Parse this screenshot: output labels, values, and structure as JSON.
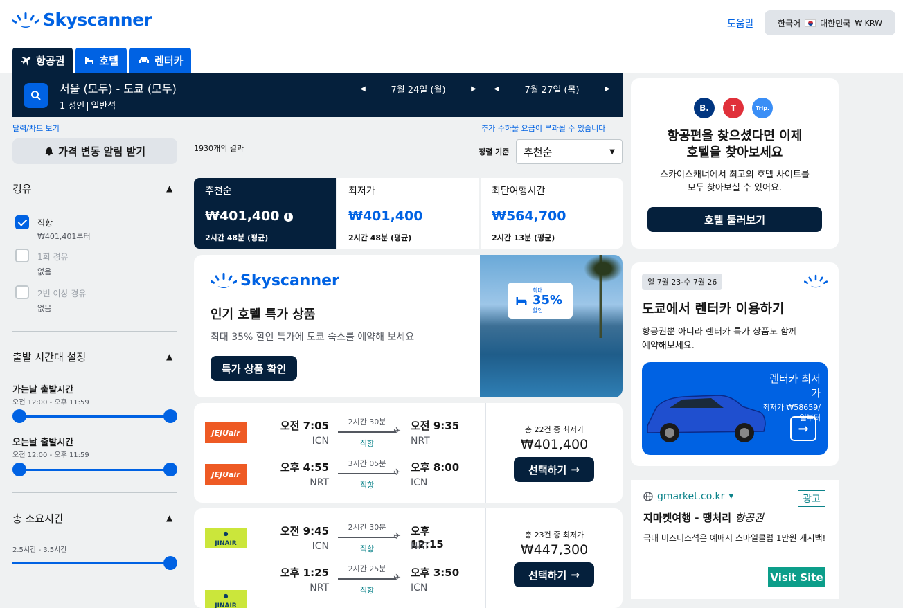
{
  "header": {
    "brand": "Skyscanner",
    "help": "도움말",
    "locale": {
      "language": "한국어",
      "country": "대한민국",
      "currency": "₩ KRW"
    }
  },
  "tabs": [
    {
      "label": "항공권",
      "icon": "plane-icon"
    },
    {
      "label": "호텔",
      "icon": "bed-icon"
    },
    {
      "label": "렌터카",
      "icon": "car-icon"
    }
  ],
  "search": {
    "route": "서울 (모두) - 도쿄 (모두)",
    "passengers": "1 성인",
    "cabin": "일반석",
    "depart_date": "7월 24일 (월)",
    "return_date": "7월 27일 (목)"
  },
  "links": {
    "calendar": "달력/차트 보기",
    "fees": "추가 수하물 요금이 부과될 수 있습니다"
  },
  "filters": {
    "price_alert": "가격 변동 알림 받기",
    "stops": {
      "title": "경유",
      "options": [
        {
          "label": "직항",
          "sub": "₩401,401부터",
          "checked": true
        },
        {
          "label": "1회 경유",
          "sub": "없음",
          "checked": false
        },
        {
          "label": "2번 이상 경유",
          "sub": "없음",
          "checked": false
        }
      ]
    },
    "departure": {
      "title": "출발 시간대 설정",
      "outbound_label": "가는날 출발시간",
      "outbound_range": "오전 12:00 - 오후 11:59",
      "return_label": "오는날 출발시간",
      "return_range": "오전 12:00 - 오후 11:59"
    },
    "duration": {
      "title": "총 소요시간",
      "range": "2.5시간 - 3.5시간"
    }
  },
  "results": {
    "count": "1930개의 결과",
    "sort_label": "정렬 기준",
    "sort_value": "추천순"
  },
  "sort_tabs": [
    {
      "name": "추천순",
      "price": "₩401,400",
      "duration": "2시간 48분 (평균)"
    },
    {
      "name": "최저가",
      "price": "₩401,400",
      "duration": "2시간 48분 (평균)"
    },
    {
      "name": "최단여행시간",
      "price": "₩564,700",
      "duration": "2시간 13분 (평균)"
    }
  ],
  "promo": {
    "brand": "Skyscanner",
    "title": "인기 호텔 특가 상품",
    "desc": "최대 35% 할인 특가에 도쿄 숙소를 예약해 보세요",
    "button": "특가 상품 확인",
    "badge_top": "최대",
    "badge_pct": "35%",
    "badge_bottom": "할인"
  },
  "flights": [
    {
      "airline": "JEJUair",
      "legs": [
        {
          "dep": "오전 7:05",
          "dep_code": "ICN",
          "dur": "2시간 30분",
          "dir": "직항",
          "arr": "오전 9:35",
          "arr_code": "NRT"
        },
        {
          "dep": "오후 4:55",
          "dep_code": "NRT",
          "dur": "3시간 05분",
          "dir": "직항",
          "arr": "오후 8:00",
          "arr_code": "ICN"
        }
      ],
      "deals": "총 22건 중 최저가",
      "price": "₩401,400",
      "button": "선택하기"
    },
    {
      "airline": "JINAIR",
      "legs": [
        {
          "dep": "오전 9:45",
          "dep_code": "ICN",
          "dur": "2시간 30분",
          "dir": "직항",
          "arr": "오후 12:15",
          "arr_code": "NRT"
        },
        {
          "dep": "오후 1:25",
          "dep_code": "NRT",
          "dur": "2시간 25분",
          "dir": "직항",
          "arr": "오후 3:50",
          "arr_code": "ICN"
        }
      ],
      "deals": "총 23건 중 최저가",
      "price": "₩447,300",
      "button": "선택하기"
    }
  ],
  "hotel_card": {
    "logos": [
      "B.",
      "T",
      "Trip."
    ],
    "title1": "항공편을 찾으셨다면 이제",
    "title2": "호텔을 찾아보세요",
    "text1": "스카이스캐너에서 최고의 호텔 사이트를",
    "text2": "모두 찾아보실 수 있어요.",
    "button": "호텔 둘러보기"
  },
  "car_card": {
    "dates": "일 7월 23-수 7월 26",
    "title": "도쿄에서 렌터카 이용하기",
    "text1": "항공권뿐 아니라 렌터카 특가 상품도 함께",
    "text2": "예약해보세요.",
    "box_title1": "렌터카 최저",
    "box_title2": "가",
    "box_sub1": "최저가 ₩58659/",
    "box_sub2": "일부터"
  },
  "ad": {
    "site": "gmarket.co.kr",
    "tag": "광고",
    "title": "지마켓여행 - 땡처리",
    "title_em": "항공권",
    "desc": "국내 비즈니스석은 예매시 스마일클럽 1만원 캐시백!",
    "button": "Visit Site"
  },
  "colors": {
    "brand": "#0062e3",
    "navy": "#05203c",
    "teal": "#0c838a"
  }
}
